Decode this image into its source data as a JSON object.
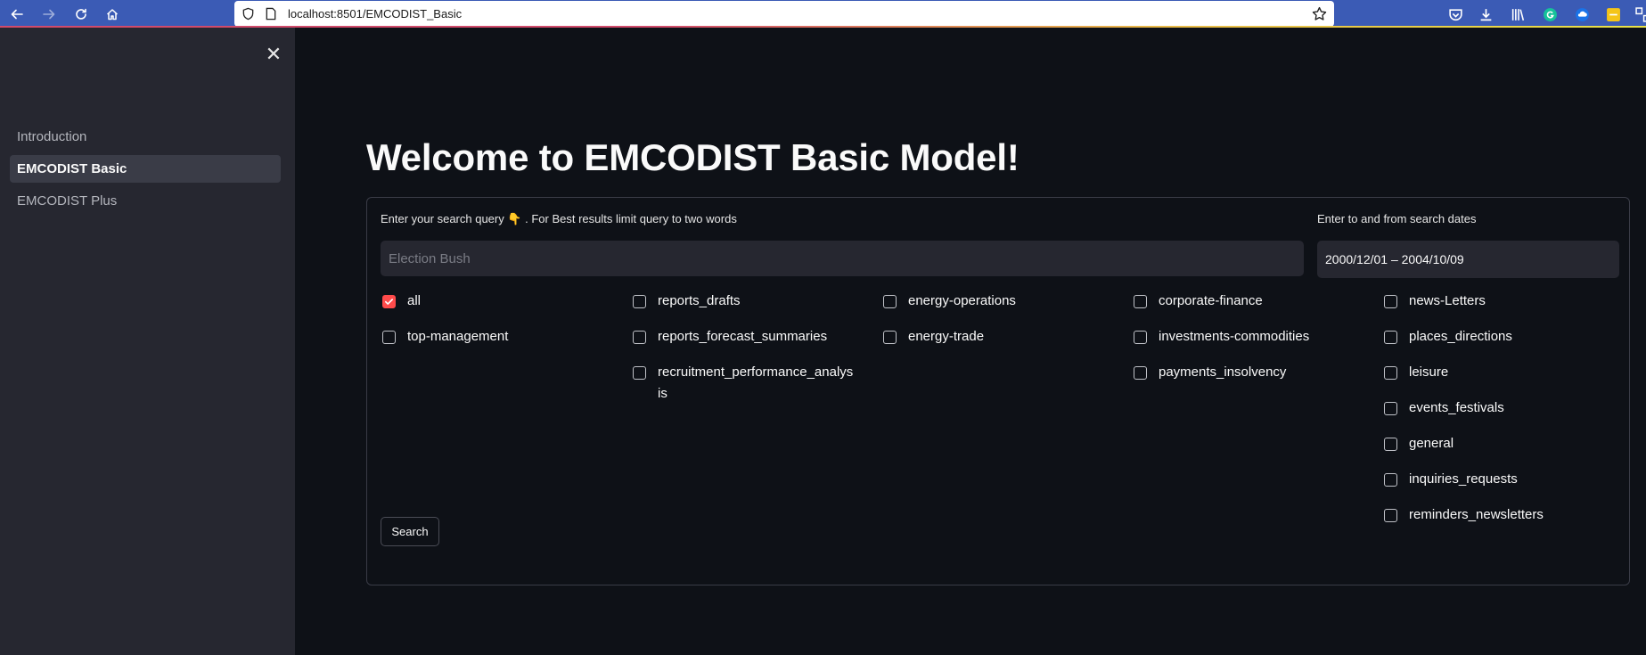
{
  "browser": {
    "url": "localhost:8501/EMCODIST_Basic"
  },
  "sidebar": {
    "items": [
      {
        "label": "Introduction"
      },
      {
        "label": "EMCODIST Basic"
      },
      {
        "label": "EMCODIST Plus"
      }
    ]
  },
  "main": {
    "title": "Welcome to EMCODIST Basic Model!",
    "query_label": "Enter your search query 👇 . For Best results limit query to two words",
    "query_placeholder": "Election Bush",
    "date_label": "Enter to and from search dates",
    "date_value": "2000/12/01 – 2004/10/09",
    "search_button": "Search"
  },
  "categories": [
    {
      "label": "all",
      "checked": true
    },
    {
      "label": "top-management",
      "checked": false
    },
    {
      "label": "reports_drafts",
      "checked": false
    },
    {
      "label": "reports_forecast_summaries",
      "checked": false
    },
    {
      "label": "recruitment_performance_analysis",
      "checked": false
    },
    {
      "label": "energy-operations",
      "checked": false
    },
    {
      "label": "energy-trade",
      "checked": false
    },
    {
      "label": "corporate-finance",
      "checked": false
    },
    {
      "label": "investments-commodities",
      "checked": false
    },
    {
      "label": "payments_insolvency",
      "checked": false
    },
    {
      "label": "news-Letters",
      "checked": false
    },
    {
      "label": "places_directions",
      "checked": false
    },
    {
      "label": "leisure",
      "checked": false
    },
    {
      "label": "events_festivals",
      "checked": false
    },
    {
      "label": "general",
      "checked": false
    },
    {
      "label": "inquiries_requests",
      "checked": false
    },
    {
      "label": "reminders_newsletters",
      "checked": false
    }
  ],
  "colors": {
    "accent": "#ff4b4b",
    "sidebar_bg": "#262730",
    "main_bg": "#0e1117",
    "browser_bar": "#3b5bb5"
  }
}
